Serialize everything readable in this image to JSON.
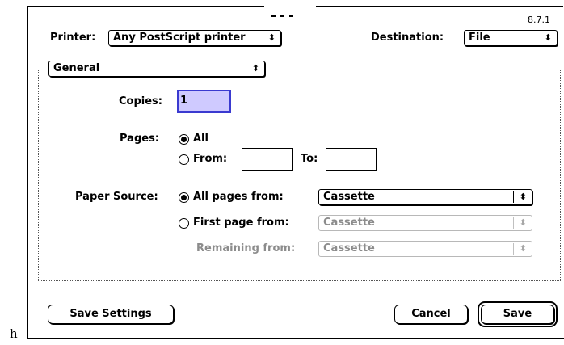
{
  "dialog": {
    "version": "8.7.1",
    "printer_label": "Printer:",
    "printer_value": "Any PostScript printer",
    "destination_label": "Destination:",
    "destination_value": "File",
    "panel_value": "General"
  },
  "copies": {
    "label": "Copies:",
    "value": "1"
  },
  "pages": {
    "label": "Pages:",
    "all_label": "All",
    "from_label": "From:",
    "from_value": "",
    "to_label": "To:",
    "to_value": "",
    "selected": "All"
  },
  "paper_source": {
    "label": "Paper Source:",
    "all_pages_label": "All pages from:",
    "all_pages_value": "Cassette",
    "first_page_label": "First page from:",
    "first_page_value": "Cassette",
    "remaining_label": "Remaining from:",
    "remaining_value": "Cassette",
    "selected": "All pages from:"
  },
  "buttons": {
    "save_settings": "Save Settings",
    "cancel": "Cancel",
    "save": "Save"
  },
  "stray_text": "h",
  "icons": {
    "popup_arrows": "up-down-arrows-icon",
    "radio": "radio-icon"
  }
}
